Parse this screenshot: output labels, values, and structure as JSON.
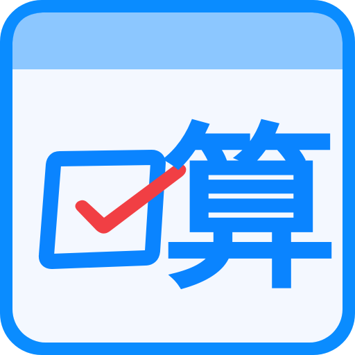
{
  "app_icon": {
    "logo_text": "口算",
    "glyph_main": "算",
    "colors": {
      "outer_frame": "#0a8cff",
      "header_band": "#8cc7ff",
      "card_bg": "#f4f8ff",
      "checkbox_stroke": "#0a84ff",
      "checkmark": "#f13f44",
      "glyph": "#0a84ff"
    },
    "icons": [
      "calendar-frame-icon",
      "checkbox-icon",
      "checkmark-icon"
    ]
  }
}
